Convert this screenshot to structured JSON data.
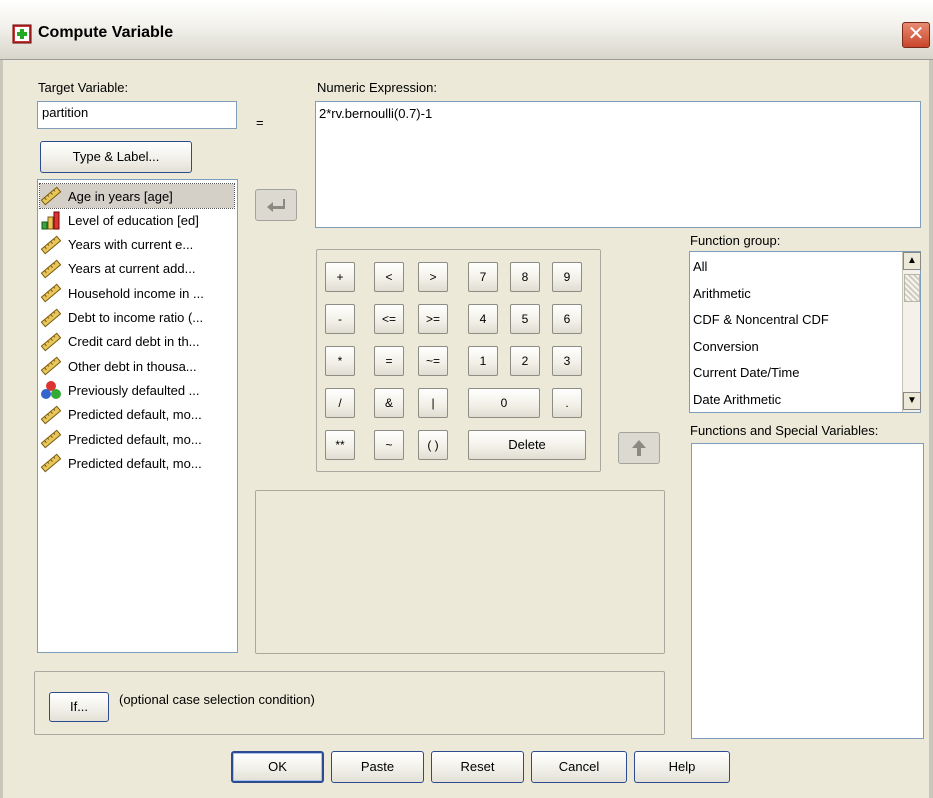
{
  "window": {
    "title": "Compute Variable",
    "close_glyph": "✕"
  },
  "target": {
    "label": "Target Variable:",
    "value": "partition",
    "type_label_button": "Type & Label..."
  },
  "equals_sign": "=",
  "expression": {
    "label": "Numeric Expression:",
    "value": "2*rv.bernoulli(0.7)-1"
  },
  "variables": [
    {
      "label": "Age in years [age]",
      "icon": "ruler-icon",
      "selected": true
    },
    {
      "label": "Level of education [ed]",
      "icon": "bar-chart-icon",
      "selected": false
    },
    {
      "label": "Years with current e...",
      "icon": "ruler-icon",
      "selected": false
    },
    {
      "label": "Years at current add...",
      "icon": "ruler-icon",
      "selected": false
    },
    {
      "label": "Household income in ...",
      "icon": "ruler-icon",
      "selected": false
    },
    {
      "label": "Debt to income ratio (...",
      "icon": "ruler-icon",
      "selected": false
    },
    {
      "label": "Credit card debt in th...",
      "icon": "ruler-icon",
      "selected": false
    },
    {
      "label": "Other debt in thousa...",
      "icon": "ruler-icon",
      "selected": false
    },
    {
      "label": "Previously defaulted ...",
      "icon": "nominal-circles-icon",
      "selected": false
    },
    {
      "label": "Predicted default, mo...",
      "icon": "ruler-icon",
      "selected": false
    },
    {
      "label": "Predicted default, mo...",
      "icon": "ruler-icon",
      "selected": false
    },
    {
      "label": "Predicted default, mo...",
      "icon": "ruler-icon",
      "selected": false
    }
  ],
  "keypad": {
    "plus": "+",
    "lt": "<",
    "gt": ">",
    "seven": "7",
    "eight": "8",
    "nine": "9",
    "minus": "-",
    "le": "<=",
    "ge": ">=",
    "four": "4",
    "five": "5",
    "six": "6",
    "times": "*",
    "eq": "=",
    "ne": "~=",
    "one": "1",
    "two": "2",
    "three": "3",
    "divide": "/",
    "and": "&",
    "or": "|",
    "zero": "0",
    "dot": ".",
    "power": "**",
    "not": "~",
    "parens": "( )",
    "delete": "Delete"
  },
  "function_group": {
    "label": "Function group:",
    "items": [
      "All",
      "Arithmetic",
      "CDF & Noncentral CDF",
      "Conversion",
      "Current Date/Time",
      "Date Arithmetic"
    ]
  },
  "functions_special": {
    "label": "Functions and Special Variables:"
  },
  "if_section": {
    "button": "If...",
    "description": "(optional case selection condition)"
  },
  "buttons": {
    "ok": "OK",
    "paste": "Paste",
    "reset": "Reset",
    "cancel": "Cancel",
    "help": "Help"
  },
  "colors": {
    "dialog_bg": "#ece9d8",
    "list_selected": "#d4d0c8",
    "button_border": "#2d4c8f"
  }
}
